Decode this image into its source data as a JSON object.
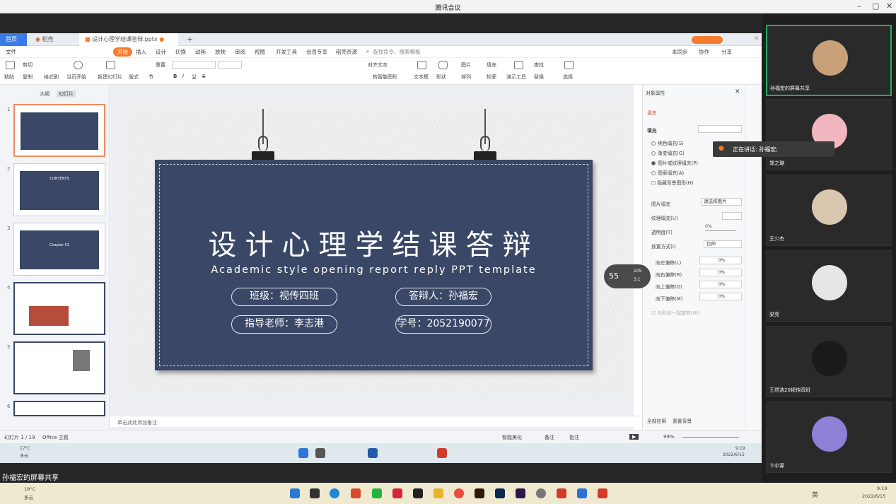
{
  "window": {
    "title": "腾讯会议"
  },
  "tabs": {
    "home": "首页",
    "t1": "稻壳",
    "file": "设计心理学结课答辩.pptx"
  },
  "menu": {
    "file": "文件",
    "items": [
      "开始",
      "插入",
      "设计",
      "切换",
      "动画",
      "放映",
      "审阅",
      "视图",
      "开发工具",
      "会员专享",
      "稻壳资源"
    ],
    "search": "查找命令、搜索模板",
    "sync": "未同步",
    "collab": "协作",
    "share": "分享"
  },
  "ribbon": {
    "paste": "粘贴",
    "cut": "剪切",
    "copy": "复制",
    "format_painter": "格式刷",
    "play_from": "当页开始",
    "new_slide": "新建幻灯片",
    "layout": "版式",
    "section": "节",
    "reset": "重置",
    "textbox": "文本框",
    "shape": "形状",
    "arrange": "排列",
    "picture": "图片",
    "fill": "填充",
    "outline": "轮廓",
    "find": "查找",
    "replace": "替换",
    "select": "选择",
    "presentation_tools": "演示工具",
    "align_text": "对齐文本",
    "smart_art": "转智能图形"
  },
  "thumbs": {
    "tab_outline": "大纲",
    "tab_slides": "幻灯片",
    "nums": [
      "1",
      "2",
      "3",
      "4",
      "5",
      "6"
    ],
    "t2_title": "CONTENTS",
    "t3_title": "Chapter 01"
  },
  "slide": {
    "title": "设计心理学结课答辩",
    "subtitle": "Academic style opening report reply PPT template",
    "class": "班级：视传四班",
    "teacher": "指导老师：李志港",
    "presenter": "答辩人：孙福宏",
    "student_id": "学号：2052190077"
  },
  "props": {
    "header": "对象属性",
    "tab": "填充",
    "section": "填充",
    "options": [
      "纯色填充(S)",
      "渐变填充(G)",
      "图片或纹理填充(P)",
      "图案填充(A)"
    ],
    "hide": "隐藏背景图形(H)",
    "pic_fill": "图片填充",
    "pic_fill_val": "请选择图片",
    "texture": "纹理填充(U)",
    "transparency": "透明度(T)",
    "transparency_val": "0%",
    "mode": "放置方式(I)",
    "mode_val": "拉伸",
    "offsets": [
      {
        "label": "向左偏移(L)",
        "val": "0%"
      },
      {
        "label": "向右偏移(R)",
        "val": "0%"
      },
      {
        "label": "向上偏移(O)",
        "val": "0%"
      },
      {
        "label": "向下偏移(M)",
        "val": "0%"
      }
    ],
    "rotate": "与形状一起旋转(W)",
    "apply_all": "全部应用",
    "reset_bg": "重置背景"
  },
  "notes": "单击此处添加备注",
  "status": {
    "slide": "幻灯片 1 / 19",
    "theme": "Office 主题",
    "beautify": "智能美化",
    "notes": "备注",
    "comment": "批注",
    "zoom": "99%"
  },
  "speed": {
    "pct": "55",
    "up": "105",
    "down": "3.1"
  },
  "inner_tb": {
    "temp": "17°C",
    "weather": "多云",
    "time": "9:19",
    "date": "2022/6/15"
  },
  "share_label": "孙福宏的屏幕共享",
  "speaking": "正在讲话: 孙福宏;",
  "participants": [
    "孙福宏的屏幕共享",
    "郑之璐",
    "王少杰",
    "梁亮",
    "王然浩20视传四班",
    "卞中源"
  ],
  "outer_tb": {
    "temp": "18°C",
    "weather": "多云",
    "lang": "英",
    "time": "9:19",
    "date": "2022/6/15"
  },
  "colors": {
    "navy": "#3a4766",
    "accent": "#f37c2f",
    "active_border": "#1fae5f"
  }
}
